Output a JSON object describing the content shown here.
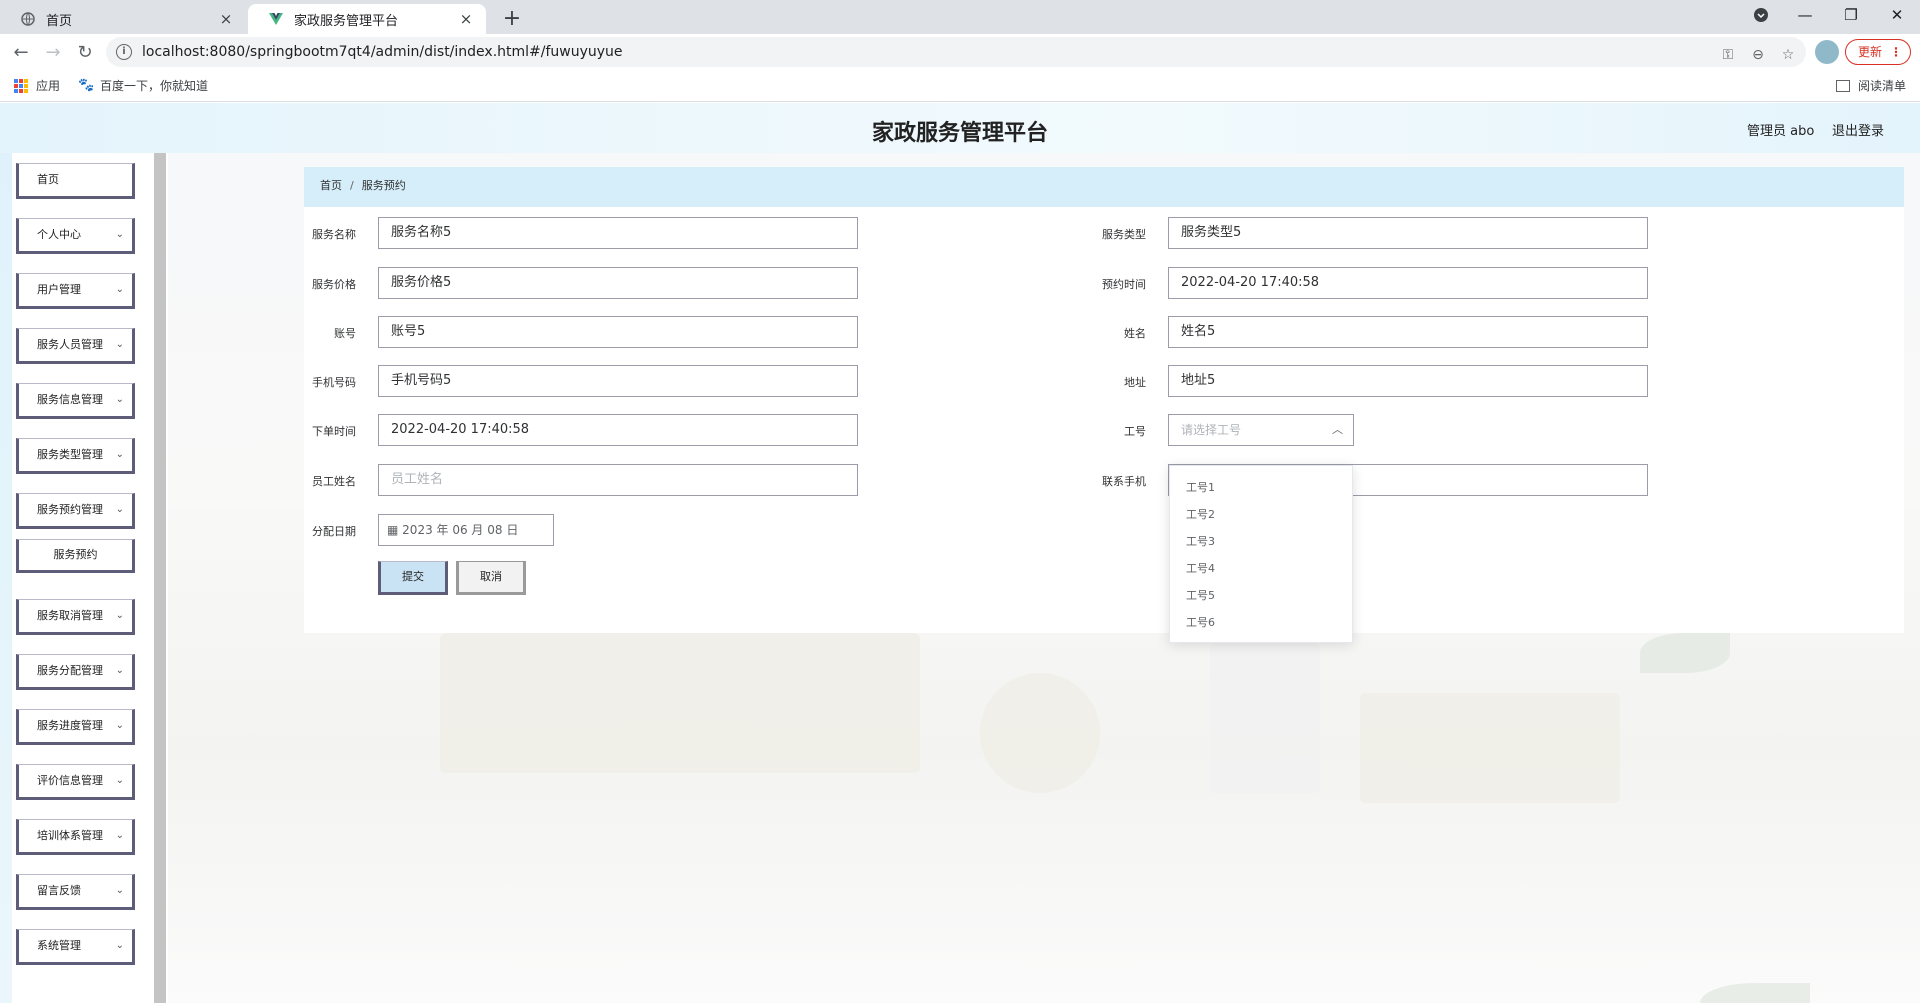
{
  "browser": {
    "tabs": [
      {
        "title": "首页",
        "active": false
      },
      {
        "title": "家政服务管理平台",
        "active": true
      }
    ],
    "url": "localhost:8080/springbootm7qt4/admin/dist/index.html#/fuwuyuyue",
    "update_label": "更新",
    "bookmarks": {
      "apps": "应用",
      "baidu": "百度一下，你就知道",
      "reading_list": "阅读清单"
    }
  },
  "header": {
    "title": "家政服务管理平台",
    "user": "管理员 abo",
    "logout": "退出登录"
  },
  "sidebar": {
    "items": [
      {
        "label": "首页"
      },
      {
        "label": "个人中心"
      },
      {
        "label": "用户管理"
      },
      {
        "label": "服务人员管理"
      },
      {
        "label": "服务信息管理"
      },
      {
        "label": "服务类型管理"
      },
      {
        "label": "服务预约管理"
      },
      {
        "label": "服务取消管理"
      },
      {
        "label": "服务分配管理"
      },
      {
        "label": "服务进度管理"
      },
      {
        "label": "评价信息管理"
      },
      {
        "label": "培训体系管理"
      },
      {
        "label": "留言反馈"
      },
      {
        "label": "系统管理"
      }
    ],
    "sub_item": "服务预约"
  },
  "breadcrumb": {
    "home": "首页",
    "sep": "/",
    "current": "服务预约"
  },
  "form": {
    "service_name": {
      "label": "服务名称",
      "value": "服务名称5"
    },
    "service_type": {
      "label": "服务类型",
      "value": "服务类型5"
    },
    "service_price": {
      "label": "服务价格",
      "value": "服务价格5"
    },
    "appointment_time": {
      "label": "预约时间",
      "value": "2022-04-20 17:40:58"
    },
    "account": {
      "label": "账号",
      "value": "账号5"
    },
    "name": {
      "label": "姓名",
      "value": "姓名5"
    },
    "phone": {
      "label": "手机号码",
      "value": "手机号码5"
    },
    "address": {
      "label": "地址",
      "value": "地址5"
    },
    "order_time": {
      "label": "下单时间",
      "value": "2022-04-20 17:40:58"
    },
    "staff_no": {
      "label": "工号",
      "placeholder": "请选择工号"
    },
    "staff_name": {
      "label": "员工姓名",
      "placeholder": "员工姓名"
    },
    "contact_phone": {
      "label": "联系手机"
    },
    "assign_date": {
      "label": "分配日期",
      "value": "2023 年 06 月 08 日"
    },
    "submit": "提交",
    "cancel": "取消"
  },
  "dropdown": {
    "options": [
      "工号1",
      "工号2",
      "工号3",
      "工号4",
      "工号5",
      "工号6"
    ]
  }
}
